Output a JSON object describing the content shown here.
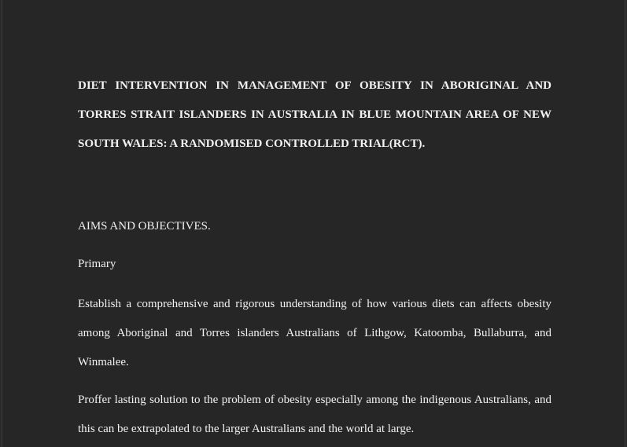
{
  "document": {
    "title": "DIET INTERVENTION IN MANAGEMENT OF OBESITY IN ABORIGINAL AND TORRES STRAIT ISLANDERS IN AUSTRALIA IN BLUE MOUNTAIN AREA OF NEW SOUTH WALES: A RANDOMISED CONTROLLED TRIAL(RCT).",
    "section_heading": "AIMS AND OBJECTIVES.",
    "subheading": "Primary",
    "paragraphs": [
      "Establish a comprehensive and rigorous understanding of how various diets can affects obesity among Aboriginal and Torres islanders Australians of Lithgow, Katoomba, Bullaburra, and Winmalee.",
      "Proffer lasting solution to the problem of obesity especially among the indigenous Australians, and this can be extrapolated to the larger Australians and the world at large."
    ]
  }
}
